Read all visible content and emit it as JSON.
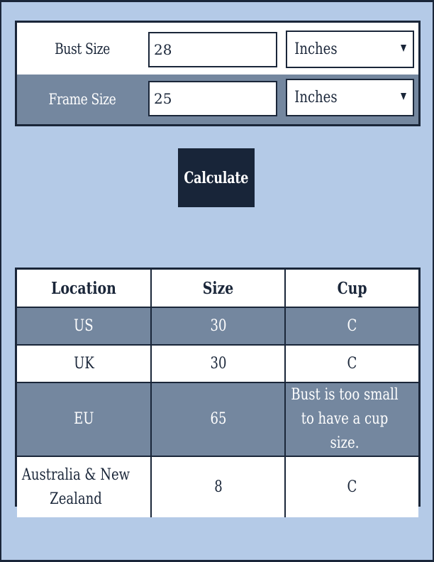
{
  "form": {
    "rows": [
      {
        "label": "Bust Size",
        "value": "28",
        "unit": "Inches"
      },
      {
        "label": "Frame Size",
        "value": "25",
        "unit": "Inches"
      }
    ]
  },
  "calculate_button": {
    "label": "Calculate"
  },
  "results": {
    "headers": [
      "Location",
      "Size",
      "Cup"
    ],
    "rows": [
      {
        "location": "US",
        "size": "30",
        "cup": "C"
      },
      {
        "location": "UK",
        "size": "30",
        "cup": "C"
      },
      {
        "location": "EU",
        "size": "65",
        "cup": "Bust is too small to have a cup size."
      },
      {
        "location": "Australia & New Zealand",
        "size": "8",
        "cup": "C"
      }
    ]
  },
  "colors": {
    "background": "#b4cae7",
    "dark_navy": "#1a2639",
    "row_slate": "#74879f",
    "white": "#ffffff"
  }
}
